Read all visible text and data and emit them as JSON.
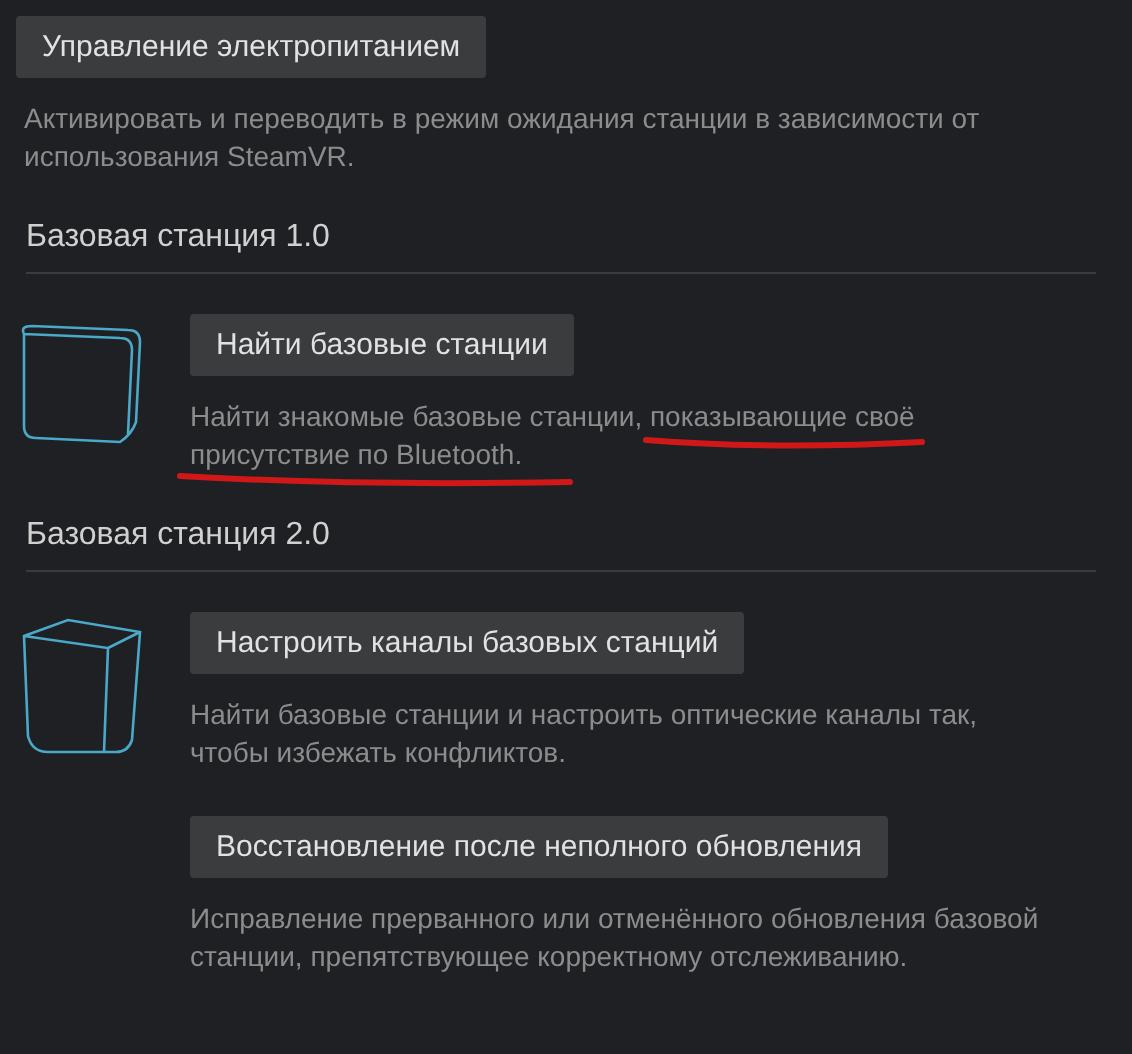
{
  "power": {
    "button": "Управление электропитанием",
    "description": "Активировать и переводить в режим ожидания станции в зависимости от использования SteamVR.",
    "underlined": false
  },
  "sections": [
    {
      "title": "Базовая станция 1.0",
      "kind": "v1",
      "actions": [
        {
          "button": "Найти базовые станции",
          "description": "Найти знакомые базовые станции, показывающие своё присутствие по Bluetooth.",
          "underlined": true
        }
      ]
    },
    {
      "title": "Базовая станция 2.0",
      "kind": "v2",
      "actions": [
        {
          "button": "Настроить каналы базовых станций",
          "description": "Найти базовые станции и настроить оптические каналы так, чтобы избежать конфликтов.",
          "underlined": false
        },
        {
          "button": "Восстановление после неполного обновления",
          "description": "Исправление прерванного или отменённого обновления базовой станции, препятствующее корректному отслеживанию.",
          "underlined": false
        }
      ]
    }
  ]
}
